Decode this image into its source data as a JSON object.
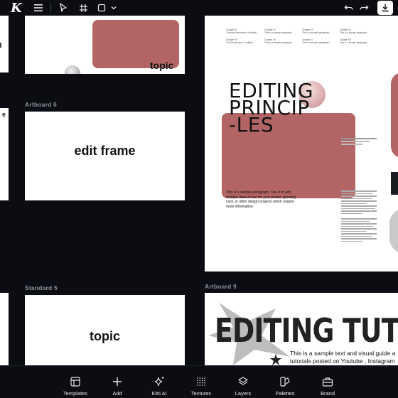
{
  "toolbar": {
    "logo": "K",
    "menu_icon": "hamburger-menu-icon",
    "select_tool_icon": "cursor-arrow-icon",
    "frame_tool_icon": "frame-hash-icon",
    "shape_tool_icon": "square-icon",
    "undo_icon": "undo-arrow-icon",
    "redo_icon": "redo-arrow-icon",
    "download_icon": "download-icon"
  },
  "canvas": {
    "top_left_board": {
      "text": "topic"
    },
    "artboard6": {
      "label": "Artboard 6",
      "text": "edit frame"
    },
    "standard5": {
      "label": "Standard 5",
      "text": "topic"
    },
    "artboard9": {
      "label": "Artboard 9",
      "title": "EDITING TUTORI",
      "body_line1": "This is a sample text and visual guide a",
      "body_line2": "tutorials posted on Youtube , Instagram"
    },
    "poster": {
      "title_line1": "EDITING",
      "title_line2": "PRINCIP",
      "title_line3": "-LES",
      "paragraph": "This is a sample paragraph. Use it to add multiple lines of text for your poster, greeting card, or other design projects which require more information.",
      "chapters": [
        {
          "title": "Chapter 01",
          "text": "The best information of editing"
        },
        {
          "title": "Chapter 02",
          "text": "This is a sample paragraph"
        },
        {
          "title": "Chapter 03",
          "text": "This is a sample paragraph"
        },
        {
          "title": "Chapter 04",
          "text": "This is a sample paragraph"
        },
        {
          "title": "Chapter 05",
          "text": "The 4th principle of editing"
        },
        {
          "title": "Chapter 06",
          "text": "This is a sample paragraph"
        },
        {
          "title": "Chapter 07",
          "text": "This is a sample paragraph"
        },
        {
          "title": "Chapter 08",
          "text": "This is a sample paragraph"
        }
      ]
    },
    "left_edge_text": "e"
  },
  "bottom_nav": [
    {
      "label": "Templates",
      "icon": "templates-layout-icon"
    },
    {
      "label": "Add",
      "icon": "plus-icon"
    },
    {
      "label": "Kitti AI",
      "icon": "sparkle-icon"
    },
    {
      "label": "Textures",
      "icon": "texture-grid-icon"
    },
    {
      "label": "Layers",
      "icon": "layers-icon"
    },
    {
      "label": "Palettes",
      "icon": "palette-icon"
    },
    {
      "label": "Brand",
      "icon": "briefcase-icon"
    }
  ],
  "colors": {
    "accent_pink": "#b36464",
    "canvas_bg": "#0b0d12",
    "toolbar_bg": "#0b0d12"
  }
}
